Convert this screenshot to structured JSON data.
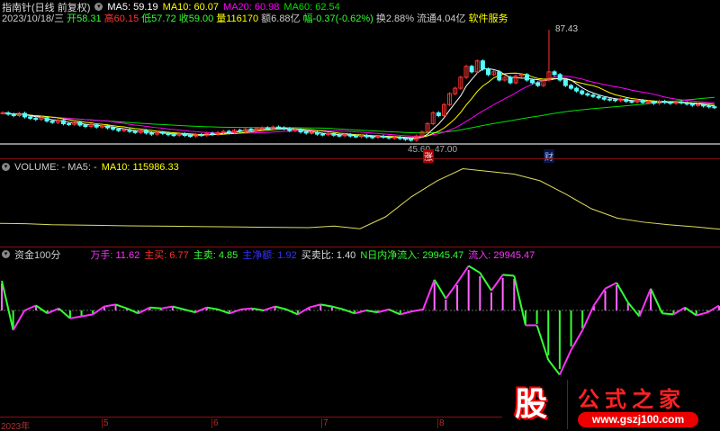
{
  "header": {
    "stock": "指南针(日线 前复权)",
    "ma5": "MA5: 59.19",
    "ma10": "MA10: 60.07",
    "ma20": "MA20: 60.98",
    "ma60": "MA60: 62.54",
    "date": "2023/10/18/三",
    "open": "开58.31",
    "high": "高60.15",
    "low": "低57.72",
    "close": "收59.00",
    "vol": "量116170",
    "amount": "额6.88亿",
    "change": "幅-0.37(-0.62%)",
    "turnover": "换2.88%",
    "float": "流通4.04亿",
    "sector": "软件服务"
  },
  "price_panel": {
    "max_label": "87.43",
    "min_label": "45.60",
    "min_label2": "47.00",
    "tag_zhang": "涨",
    "tag_cai": "财"
  },
  "volume_panel": {
    "title": "VOLUME: -  MA5: -",
    "ma10": "MA10: 115986.33"
  },
  "indicator_panel": {
    "title": "资金100分",
    "wanshou": "万手: 11.62",
    "zhumai": "主买: 6.77",
    "zhumai2": "主卖: 4.85",
    "zhujinge": "主净额: 1.92",
    "ratio": "买卖比: 1.40",
    "nday": "N日内净流入: 29945.47",
    "inflow": "流入: 29945.47"
  },
  "time_axis": [
    "2023年",
    "5",
    "6",
    "7",
    "8"
  ],
  "logo": {
    "char": "股",
    "name": "公式之家",
    "url": "www.gszj100.com"
  },
  "colors": {
    "up": "#ff3232",
    "down": "#54ffff",
    "ma5": "#ffffff",
    "ma10": "#ffff00",
    "ma20": "#ff00ff",
    "ma60": "#00e000"
  },
  "chart_data": {
    "type": "candlestick",
    "price_range": [
      45.6,
      87.43
    ],
    "closes": [
      57,
      56.5,
      56,
      56.8,
      55.5,
      55,
      54.6,
      55.2,
      54,
      53.5,
      54.2,
      53,
      52.8,
      53.5,
      52.5,
      52,
      52.6,
      51.8,
      52.2,
      51.5,
      51,
      50.5,
      50.8,
      50.2,
      49.8,
      50.5,
      49.6,
      49.2,
      49.8,
      49.5,
      49,
      48.8,
      49.3,
      48.7,
      48.5,
      49,
      48.8,
      49.5,
      49.2,
      49.8,
      50.2,
      50,
      50.6,
      50.3,
      51,
      50.8,
      51.2,
      51.5,
      51,
      51.8,
      51.5,
      51.2,
      50.5,
      50.8,
      50,
      49.6,
      49.8,
      49.2,
      49,
      49.4,
      48.8,
      48.6,
      49,
      48.5,
      48.3,
      48.7,
      48.2,
      48,
      48.4,
      48.1,
      47.8,
      48,
      47.6,
      47.3,
      47,
      48.5,
      50,
      53,
      57,
      56,
      60,
      64,
      66,
      70,
      74,
      72,
      76,
      73,
      71,
      72,
      69,
      70,
      68,
      70.5,
      71,
      69,
      68,
      67,
      69,
      72,
      71,
      69,
      67,
      66,
      65,
      64,
      63.5,
      63,
      62.5,
      62,
      61.8,
      61.5,
      62,
      61.2,
      61,
      61.5,
      60.8,
      61,
      60.5,
      61.2,
      60.8,
      60.5,
      61,
      60.6,
      60.2,
      59.8,
      60,
      59.5,
      59.2,
      59
    ],
    "spike_index": 99,
    "spike_high": 87.43,
    "volume_ma10": [
      160000,
      158000,
      150000,
      148000,
      145000,
      142000,
      140000,
      138000,
      136000,
      134000,
      132000,
      130000,
      128000,
      140000,
      120000,
      210000,
      360000,
      480000,
      570000,
      550000,
      530000,
      480000,
      380000,
      270000,
      200000,
      170000,
      150000,
      135000,
      116000
    ],
    "fund_index": [
      30,
      -20,
      0,
      5,
      -3,
      2,
      -8,
      -6,
      -4,
      4,
      6,
      2,
      -3,
      3,
      2,
      4,
      1,
      -2,
      3,
      1,
      -3,
      1,
      2,
      0,
      4,
      1,
      -4,
      3,
      6,
      4,
      1,
      -3,
      0,
      -2,
      1,
      -4,
      -1,
      1,
      31,
      12,
      28,
      45,
      38,
      20,
      36,
      35,
      -15,
      -15,
      -50,
      -65,
      -40,
      -20,
      5,
      22,
      28,
      8,
      -6,
      22,
      -3,
      -4,
      3,
      -5,
      -2,
      5
    ]
  }
}
